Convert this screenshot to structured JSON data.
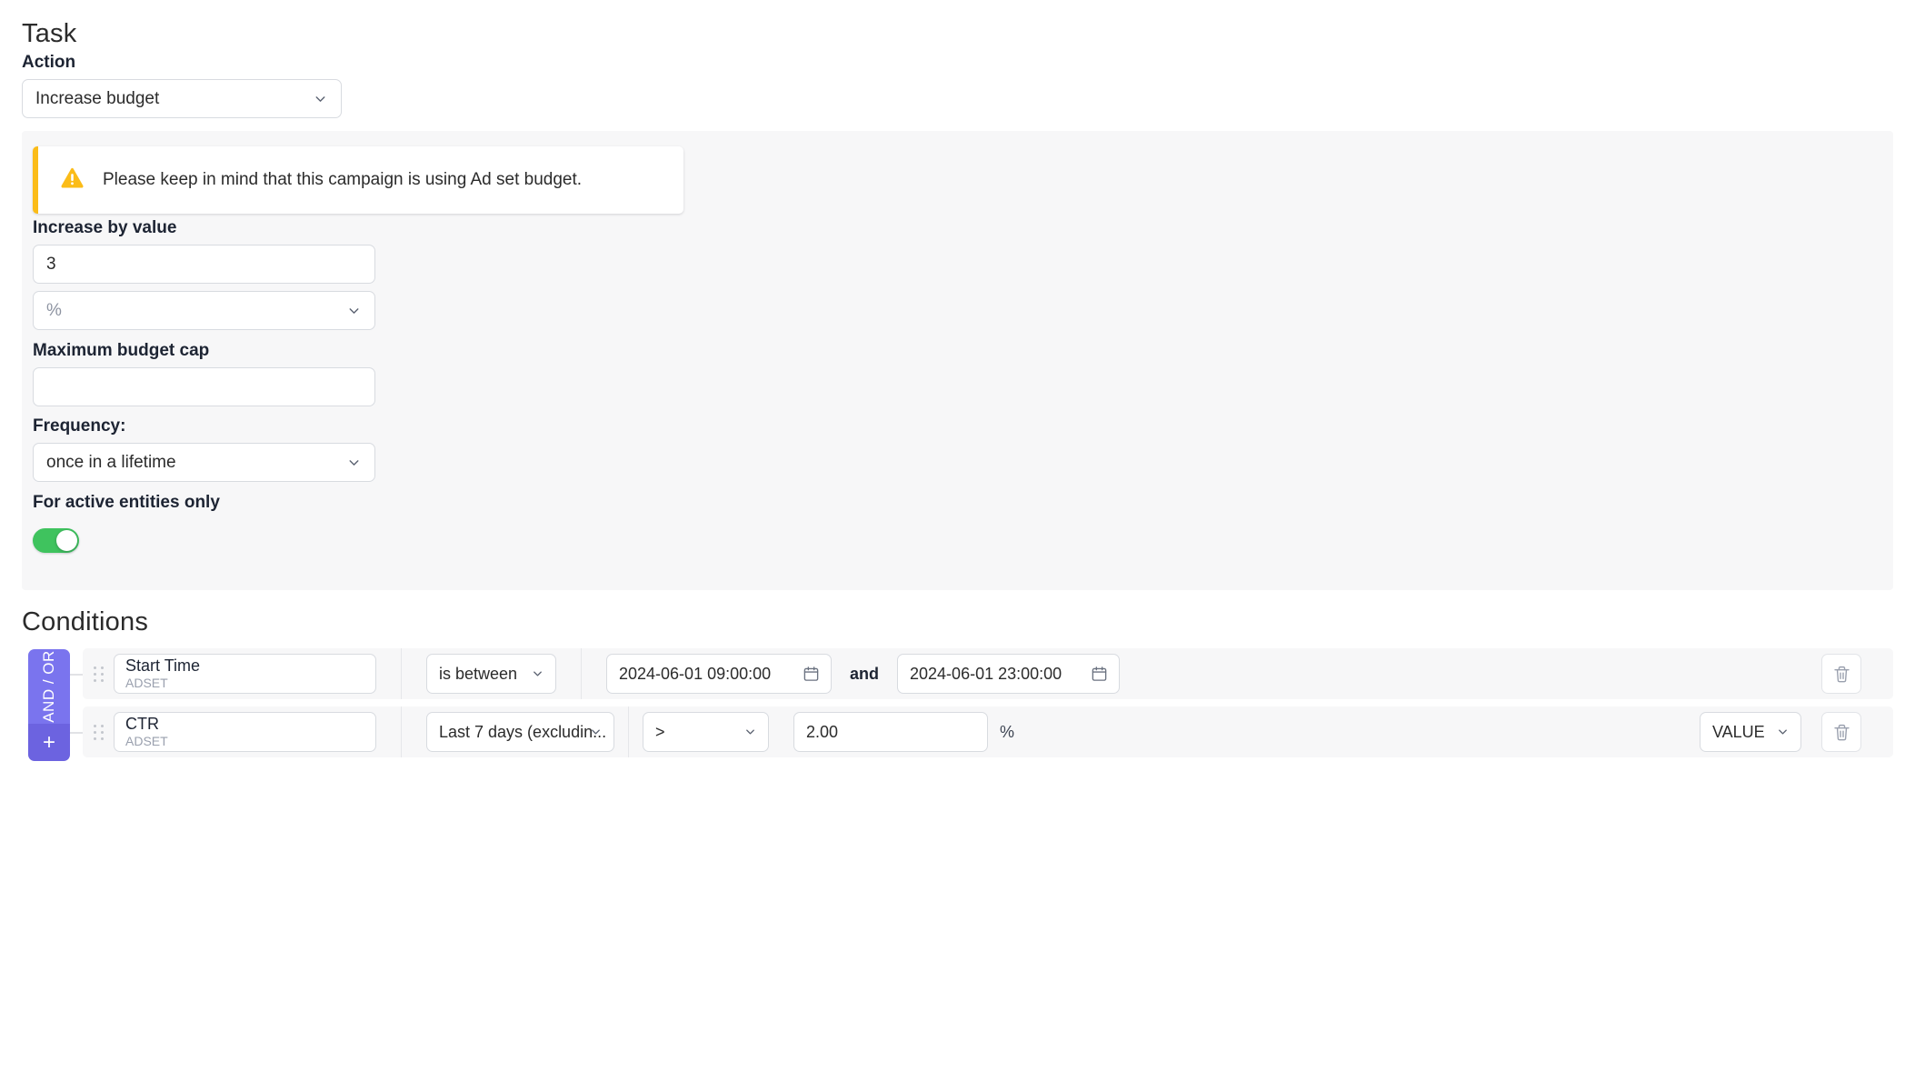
{
  "task": {
    "title": "Task",
    "action_label": "Action",
    "action_value": "Increase budget",
    "warning": {
      "icon": "warning-triangle-icon",
      "message": "Please keep in mind that this campaign is using Ad set budget."
    },
    "increase_label": "Increase by value",
    "increase_value": "3",
    "unit_value": "%",
    "maxcap_label": "Maximum budget cap",
    "maxcap_value": "",
    "frequency_label": "Frequency:",
    "frequency_value": "once in a lifetime",
    "active_label": "For active entities only",
    "active_toggle_on": true
  },
  "conditions": {
    "title": "Conditions",
    "group_operator": "AND / OR",
    "add_label": "+",
    "rows": [
      {
        "metric": "Start Time",
        "level": "ADSET",
        "operator": "is between",
        "value_from": "2024-06-01 09:00:00",
        "conjunction": "and",
        "value_to": "2024-06-01 23:00:00",
        "delete_icon": "trash-icon"
      },
      {
        "metric": "CTR",
        "level": "ADSET",
        "timeframe": "Last 7 days (excludin...",
        "comparator": ">",
        "value": "2.00",
        "unit": "%",
        "value_type": "VALUE",
        "delete_icon": "trash-icon"
      }
    ]
  },
  "colors": {
    "accent_purple": "#7a74ee",
    "accent_purple_dark": "#6c63e0",
    "toggle_green": "#3fc35e",
    "warning_yellow": "#fbbc18",
    "panel_grey": "#f7f7f8"
  }
}
